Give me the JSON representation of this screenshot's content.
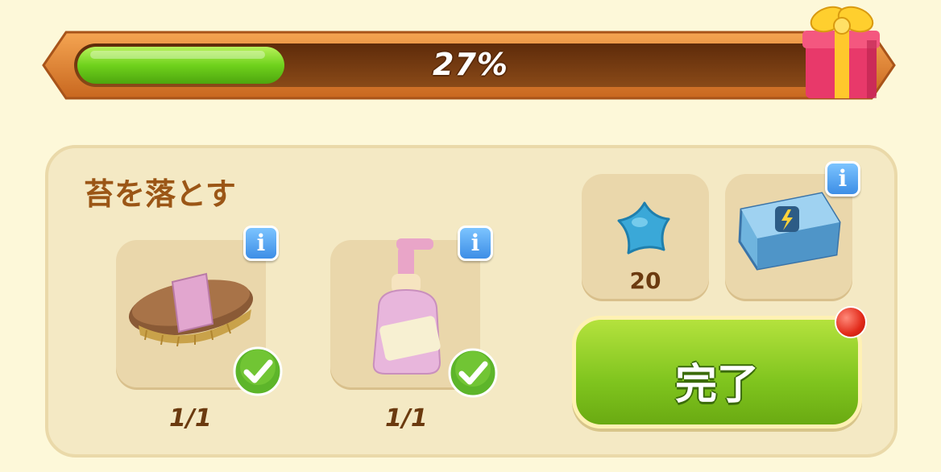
{
  "progress": {
    "label": "27%",
    "fraction": 0.27
  },
  "task": {
    "title": "苔を落とす",
    "items": [
      {
        "name": "brush",
        "count": "1/1",
        "done": true
      },
      {
        "name": "soap-bottle",
        "count": "1/1",
        "done": true
      }
    ]
  },
  "rewards": [
    {
      "name": "blue-star",
      "amount": "20"
    },
    {
      "name": "energy-chest"
    }
  ],
  "complete_button": {
    "label": "完了"
  },
  "colors": {
    "bar_fill": "#6fd21c",
    "bar_track": "#7c3f12",
    "button": "#8fd22a",
    "title": "#9b5616"
  }
}
